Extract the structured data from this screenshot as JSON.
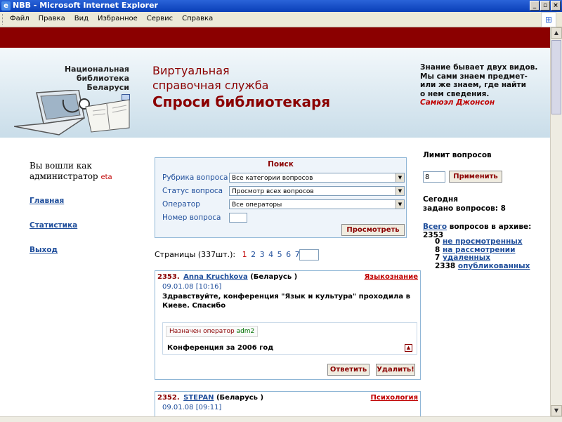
{
  "window": {
    "title": "NBB - Microsoft Internet Explorer"
  },
  "menu": [
    "Файл",
    "Правка",
    "Вид",
    "Избранное",
    "Сервис",
    "Справка"
  ],
  "header": {
    "library_lines": [
      "Национальная",
      "библиотека",
      "Беларуси"
    ],
    "service_line1": "Виртуальная",
    "service_line2": "справочная служба",
    "service_line3": "Спроси библиотекаря",
    "quote": "Знание бывает двух видов.\nМы сами знаем предмет-\nили же знаем, где найти\nо нем сведения.",
    "quote_author": "Самюэл Джонсон"
  },
  "sidebar": {
    "welcome": "Вы вошли как администратор",
    "username": "eta",
    "links": [
      "Главная",
      "Статистика",
      "Выход"
    ]
  },
  "search": {
    "title": "Поиск",
    "rubric_label": "Рубрика вопроса",
    "rubric_value": "Все категории вопросов",
    "status_label": "Статус вопроса",
    "status_value": "Просмотр всех вопросов",
    "operator_label": "Оператор",
    "operator_value": "Все операторы",
    "number_label": "Номер вопроса",
    "view_button": "Просмотреть"
  },
  "pagination": {
    "label": "Страницы (337шт.):",
    "current": "1",
    "pages": [
      "2",
      "3",
      "4",
      "5",
      "6",
      "7"
    ],
    "more": "»"
  },
  "questions": [
    {
      "number": "2353.",
      "author": "Anna Kruchkova",
      "country": "(Беларусь )",
      "category": "Языкознание",
      "date": "09.01.08 [10:16]",
      "text": "Здравствуйте, конференция \"Язык и культура\" проходила в Киеве. Спасибо",
      "assigned_label": "Назначен оператор",
      "assigned_operator": "adm2",
      "answer": "Конференция за 2006 год",
      "reply_button": "Ответить",
      "delete_button": "Удалить!"
    },
    {
      "number": "2352.",
      "author": "STEPAN",
      "country": "(Беларусь )",
      "category": "Психология",
      "date": "09.01.08 [09:11]"
    }
  ],
  "right_panel": {
    "limit_title": "Лимит вопросов",
    "limit_value": "8",
    "apply_button": "Применить",
    "today_line1": "Сегодня",
    "today_line2": "задано вопросов: 8",
    "total_link": "Всего",
    "total_text": "вопросов в архиве: 2353",
    "stats": [
      {
        "count": "0",
        "label": "не просмотренных"
      },
      {
        "count": "8",
        "label": "на рассмотрении"
      },
      {
        "count": "7",
        "label": "удаленных"
      },
      {
        "count": "2338",
        "label": "опубликованных"
      }
    ]
  }
}
